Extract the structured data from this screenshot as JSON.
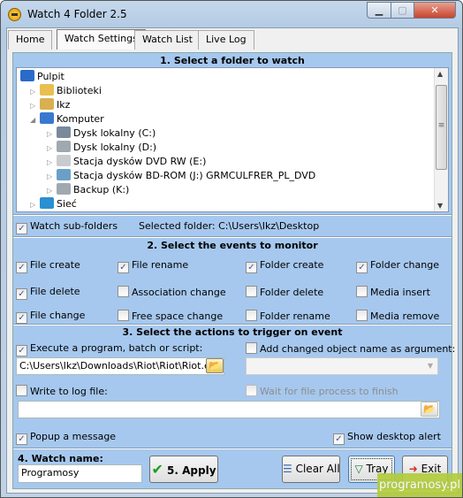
{
  "window": {
    "title": "Watch 4 Folder 2.5",
    "minimize": "▁",
    "maximize": "▢",
    "close": "✕"
  },
  "tabs": [
    {
      "label": "Home"
    },
    {
      "label": "Watch Settings",
      "active": true
    },
    {
      "label": "Watch List"
    },
    {
      "label": "Live Log"
    }
  ],
  "section1": {
    "header": "1. Select a folder to watch",
    "tree": [
      {
        "label": "Pulpit",
        "icon": "desktop-icon",
        "level": 0,
        "expander": ""
      },
      {
        "label": "Biblioteki",
        "icon": "libraries-icon",
        "level": 1,
        "expander": "▷"
      },
      {
        "label": "Ikz",
        "icon": "user-folder-icon",
        "level": 1,
        "expander": "▷"
      },
      {
        "label": "Komputer",
        "icon": "computer-icon",
        "level": 1,
        "expander": "◢"
      },
      {
        "label": "Dysk lokalny (C:)",
        "icon": "system-drive-icon",
        "level": 2,
        "expander": "▷"
      },
      {
        "label": "Dysk lokalny (D:)",
        "icon": "hard-drive-icon",
        "level": 2,
        "expander": "▷"
      },
      {
        "label": "Stacja dysków DVD RW (E:)",
        "icon": "dvd-drive-icon",
        "level": 2,
        "expander": "▷"
      },
      {
        "label": "Stacja dysków BD-ROM (J:) GRMCULFRER_PL_DVD",
        "icon": "bd-drive-icon",
        "level": 2,
        "expander": "▷"
      },
      {
        "label": "Backup (K:)",
        "icon": "hard-drive-icon",
        "level": 2,
        "expander": "▷"
      },
      {
        "label": "Sieć",
        "icon": "network-icon",
        "level": 1,
        "expander": "▷"
      }
    ],
    "watch_subfolders": {
      "label": "Watch sub-folders",
      "checked": true
    },
    "selected_folder": "Selected folder: C:\\Users\\Ikz\\Desktop"
  },
  "section2": {
    "header": "2. Select the events to monitor",
    "events": [
      {
        "label": "File create",
        "checked": true
      },
      {
        "label": "File rename",
        "checked": true
      },
      {
        "label": "Folder create",
        "checked": true
      },
      {
        "label": "Folder change",
        "checked": true
      },
      {
        "label": "File delete",
        "checked": true
      },
      {
        "label": "Association change",
        "checked": false
      },
      {
        "label": "Folder delete",
        "checked": false
      },
      {
        "label": "Media insert",
        "checked": false
      },
      {
        "label": "File change",
        "checked": true
      },
      {
        "label": "Free space change",
        "checked": false
      },
      {
        "label": "Folder rename",
        "checked": false
      },
      {
        "label": "Media remove",
        "checked": false
      }
    ]
  },
  "section3": {
    "header": "3. Select the actions to trigger on event",
    "execute": {
      "label": "Execute a program, batch or script:",
      "checked": true,
      "value": "C:\\Users\\Ikz\\Downloads\\Riot\\Riot\\Riot.exe"
    },
    "add_arg": {
      "label": "Add changed object name as argument:",
      "checked": false,
      "value": ""
    },
    "write_log": {
      "label": "Write to log file:",
      "checked": false,
      "value": ""
    },
    "wait": {
      "label": "Wait for file process to finish",
      "checked": false,
      "disabled": true
    },
    "popup": {
      "label": "Popup a message",
      "checked": true
    },
    "desktop_alert": {
      "label": "Show desktop alert",
      "checked": true
    }
  },
  "bottom": {
    "watch_name_label": "4. Watch name:",
    "watch_name": "Programosy",
    "apply": "5. Apply",
    "clear_all": "Clear All",
    "tray": "Tray",
    "exit": "Exit"
  },
  "watermark": "programosy.pl",
  "colors": {
    "panel": "#a6c8ee",
    "accent_check": "#3a5a9a",
    "apply_check": "#1f9a1f"
  }
}
